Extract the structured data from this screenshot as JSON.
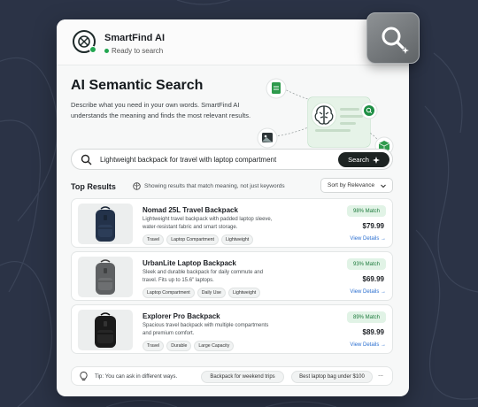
{
  "header": {
    "app_name": "SmartFind AI",
    "status": "Ready to search"
  },
  "hero": {
    "title": "AI Semantic Search",
    "description": "Describe what you need in your own words. SmartFind AI understands the meaning and finds the most relevant results."
  },
  "search": {
    "query": "Lightweight backpack for travel with laptop compartment",
    "button_label": "Search"
  },
  "results_header": {
    "title": "Top Results",
    "note": "Showing results that match meaning, not just keywords",
    "sort_label": "Sort by Relevance"
  },
  "results": [
    {
      "name": "Nomad 25L Travel Backpack",
      "description": "Lightweight travel backpack with padded laptop sleeve, water-resistant fabric and smart storage.",
      "tags": [
        "Travel",
        "Laptop Compartment",
        "Lightweight"
      ],
      "match": "98% Match",
      "price": "$79.99",
      "details_label": "View Details"
    },
    {
      "name": "UrbanLite Laptop Backpack",
      "description": "Sleek and durable backpack for daily commute and travel. Fits up to 15.6\" laptops.",
      "tags": [
        "Laptop Compartment",
        "Daily Use",
        "Lightweight"
      ],
      "match": "93% Match",
      "price": "$69.99",
      "details_label": "View Details"
    },
    {
      "name": "Explorer Pro Backpack",
      "description": "Spacious travel backpack with multiple compartments and premium comfort.",
      "tags": [
        "Travel",
        "Durable",
        "Large Capacity"
      ],
      "match": "89% Match",
      "price": "$89.99",
      "details_label": "View Details"
    }
  ],
  "tip": {
    "text": "Tip: You can ask in different ways.",
    "suggestions": [
      "Backpack for weekend trips",
      "Best laptop bag under $100"
    ],
    "more": "..."
  },
  "colors": {
    "accent_green": "#22a650",
    "dark_button": "#1d2322",
    "link_blue": "#2b6fd0",
    "background": "#2b3346"
  }
}
